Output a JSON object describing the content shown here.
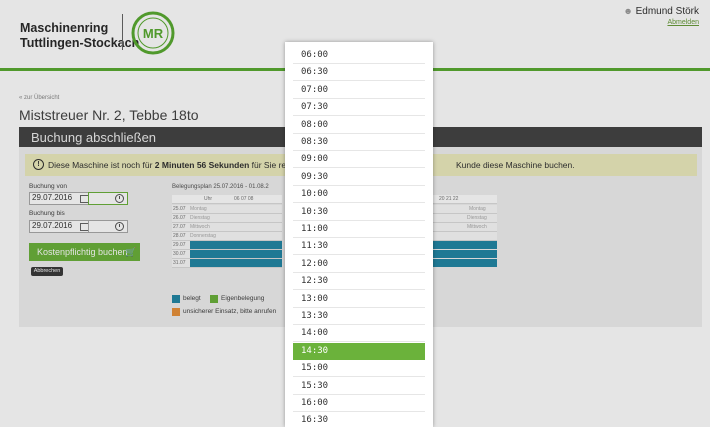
{
  "header": {
    "brand_line1": "Maschinenring",
    "brand_line2": "Tuttlingen-Stockach",
    "logo_text": "MR",
    "user_name": "Edmund Störk",
    "logout": "Abmelden"
  },
  "back_link": "« zur Übersicht",
  "page_title": "Miststreuer Nr. 2, Tebbe 18to",
  "section_title": "Buchung abschließen",
  "notice": {
    "part1": "Diese Maschine ist noch für",
    "bold": "2 Minuten 56 Sekunden",
    "part2": "für Sie res",
    "part3": "Kunde diese Maschine buchen."
  },
  "form": {
    "from_label": "Buchung von",
    "from_date": "29.07.2016",
    "to_label": "Buchung bis",
    "to_date": "29.07.2016",
    "book_button": "Kostenpflichtig buchen",
    "cancel_button": "Abbrechen"
  },
  "plan": {
    "title": "Belegungsplan 25.07.2016 - 01.08.2",
    "header_left": "Uhr",
    "header_hours": "06 07 08",
    "header_right": "20 21 22",
    "rows": [
      {
        "date": "25.07",
        "weekday": "Montag",
        "right": "Montag"
      },
      {
        "date": "26.07",
        "weekday": "Dienstag",
        "right": "Dienstag"
      },
      {
        "date": "27.07",
        "weekday": "Mittwoch",
        "right": "Mittwoch"
      },
      {
        "date": "28.07",
        "weekday": "Donnerstag",
        "right": ""
      },
      {
        "date": "29.07",
        "weekday": "",
        "right": ""
      },
      {
        "date": "30.07",
        "weekday": "",
        "right": ""
      },
      {
        "date": "31.07",
        "weekday": "",
        "right": ""
      }
    ],
    "legend": {
      "busy": "belegt",
      "own": "Eigenbelegung",
      "uncertain": "unsicherer Einsatz, bitte anrufen"
    },
    "colors": {
      "busy": "#2387a5",
      "own": "#6bb23b",
      "uncertain": "#e8913a"
    }
  },
  "time_dropdown": {
    "options": [
      "06:00",
      "06:30",
      "07:00",
      "07:30",
      "08:00",
      "08:30",
      "09:00",
      "09:30",
      "10:00",
      "10:30",
      "11:00",
      "11:30",
      "12:00",
      "12:30",
      "13:00",
      "13:30",
      "14:00",
      "14:30",
      "15:00",
      "15:30",
      "16:00",
      "16:30"
    ],
    "selected": "14:30"
  }
}
